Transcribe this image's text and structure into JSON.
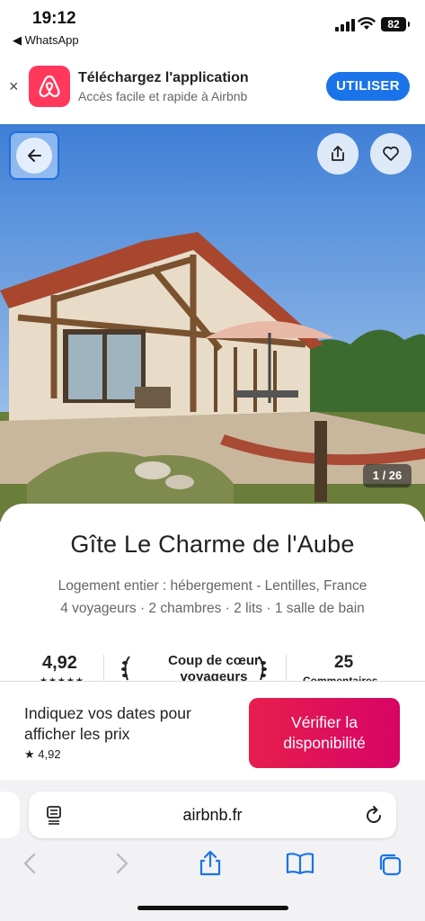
{
  "status_bar": {
    "time": "19:12",
    "back_app": "◀ WhatsApp",
    "battery": "82"
  },
  "app_banner": {
    "close_glyph": "×",
    "title": "Téléchargez l'application",
    "subtitle": "Accès facile et rapide à Airbnb",
    "button_label": "UTILISER",
    "brand_color": "#ff385c"
  },
  "hero": {
    "photo_counter": "1 / 26",
    "icons": [
      "back-arrow-icon",
      "share-icon",
      "heart-icon"
    ]
  },
  "listing": {
    "title": "Gîte Le Charme de l'Aube",
    "subtitle_line1": "Logement entier : hébergement - Lentilles, France",
    "subtitle_line2": "4 voyageurs · 2 chambres · 2 lits · 1 salle de bain",
    "rating": "4,92",
    "stars": "★★★★★",
    "badge_line1": "Coup de cœur",
    "badge_line2": "voyageurs",
    "reviews_count": "25",
    "reviews_label": "Commentaires"
  },
  "booking": {
    "prompt": "Indiquez vos dates pour afficher les prix",
    "rating": "4,92",
    "button_label": "Vérifier la disponibilité",
    "button_color": "#e61e4d"
  },
  "browser": {
    "url": "airbnb.fr",
    "accent": "#1a73e8"
  }
}
